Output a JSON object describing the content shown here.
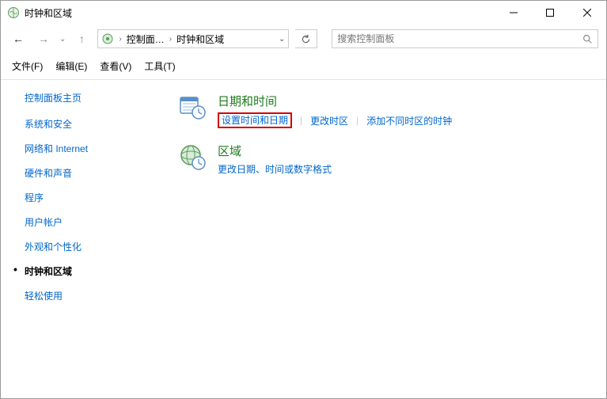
{
  "window": {
    "title": "时钟和区域"
  },
  "nav": {
    "back_enabled": true,
    "forward_enabled": false,
    "breadcrumbs": {
      "level1": "控制面…",
      "level2": "时钟和区域"
    },
    "search_placeholder": "搜索控制面板"
  },
  "menu": {
    "file": "文件(F)",
    "edit": "编辑(E)",
    "view": "查看(V)",
    "tools": "工具(T)"
  },
  "sidebar": {
    "home": "控制面板主页",
    "items": [
      {
        "label": "系统和安全"
      },
      {
        "label": "网络和 Internet"
      },
      {
        "label": "硬件和声音"
      },
      {
        "label": "程序"
      },
      {
        "label": "用户帐户"
      },
      {
        "label": "外观和个性化"
      },
      {
        "label": "时钟和区域",
        "active": true
      },
      {
        "label": "轻松使用"
      }
    ]
  },
  "content": {
    "sections": [
      {
        "title": "日期和时间",
        "icon": "calendar-clock-icon",
        "links": [
          {
            "label": "设置时间和日期",
            "highlighted": true
          },
          {
            "label": "更改时区"
          },
          {
            "label": "添加不同时区的时钟"
          }
        ]
      },
      {
        "title": "区域",
        "icon": "globe-clock-icon",
        "links": [
          {
            "label": "更改日期、时间或数字格式"
          }
        ]
      }
    ]
  }
}
